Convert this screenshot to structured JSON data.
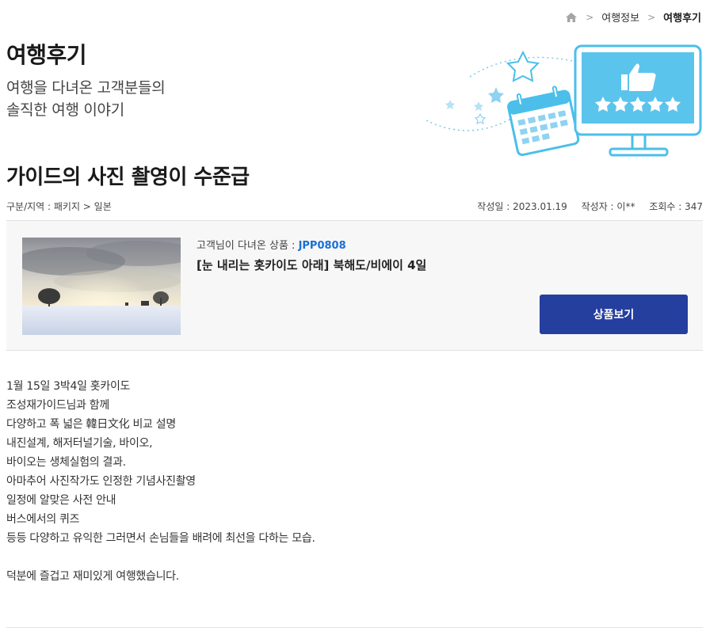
{
  "breadcrumb": {
    "home_icon": "home-icon",
    "items": [
      "여행정보",
      "여행후기"
    ]
  },
  "header": {
    "title": "여행후기",
    "subtitle_line1": "여행을 다녀온 고객분들의",
    "subtitle_line2": "솔직한 여행 이야기"
  },
  "illustration": {
    "icons": [
      "star-icon",
      "calendar-icon",
      "monitor-icon",
      "thumbs-up-icon",
      "rating-stars-icon"
    ],
    "accent": "#4bbfea"
  },
  "post": {
    "title": "가이드의 사진 촬영이 수준급",
    "category": "구분/지역 : 패키지 > 일본",
    "date": "작성일 : 2023.01.19",
    "author": "작성자 : 이**",
    "views": "조회수 : 347"
  },
  "product": {
    "label": "고객님이 다녀온 상품 : ",
    "code": "JPP0808",
    "name": "[눈 내리는 홋카이도 아래] 북해도/비에이 4일",
    "button_label": "상품보기",
    "button_color": "#253f9f"
  },
  "body": {
    "lines": [
      " 1월 15일 3박4일 홋카이도",
      "조성재가이드님과 함께",
      "다양하고 폭 넓은 韓日文化 비교 설명",
      "내진설계, 해저터널기술, 바이오,",
      "바이오는 생체실험의 결과.",
      "아마추어 사진작가도 인정한 기념사진촬영",
      "일정에 알맞은 사전 안내",
      "버스에서의 퀴즈",
      "등등 다양하고 유익한 그러면서 손님들을 배려에 최선을 다하는 모습.",
      "",
      "덕분에 즐겁고 재미있게 여행했습니다."
    ]
  }
}
